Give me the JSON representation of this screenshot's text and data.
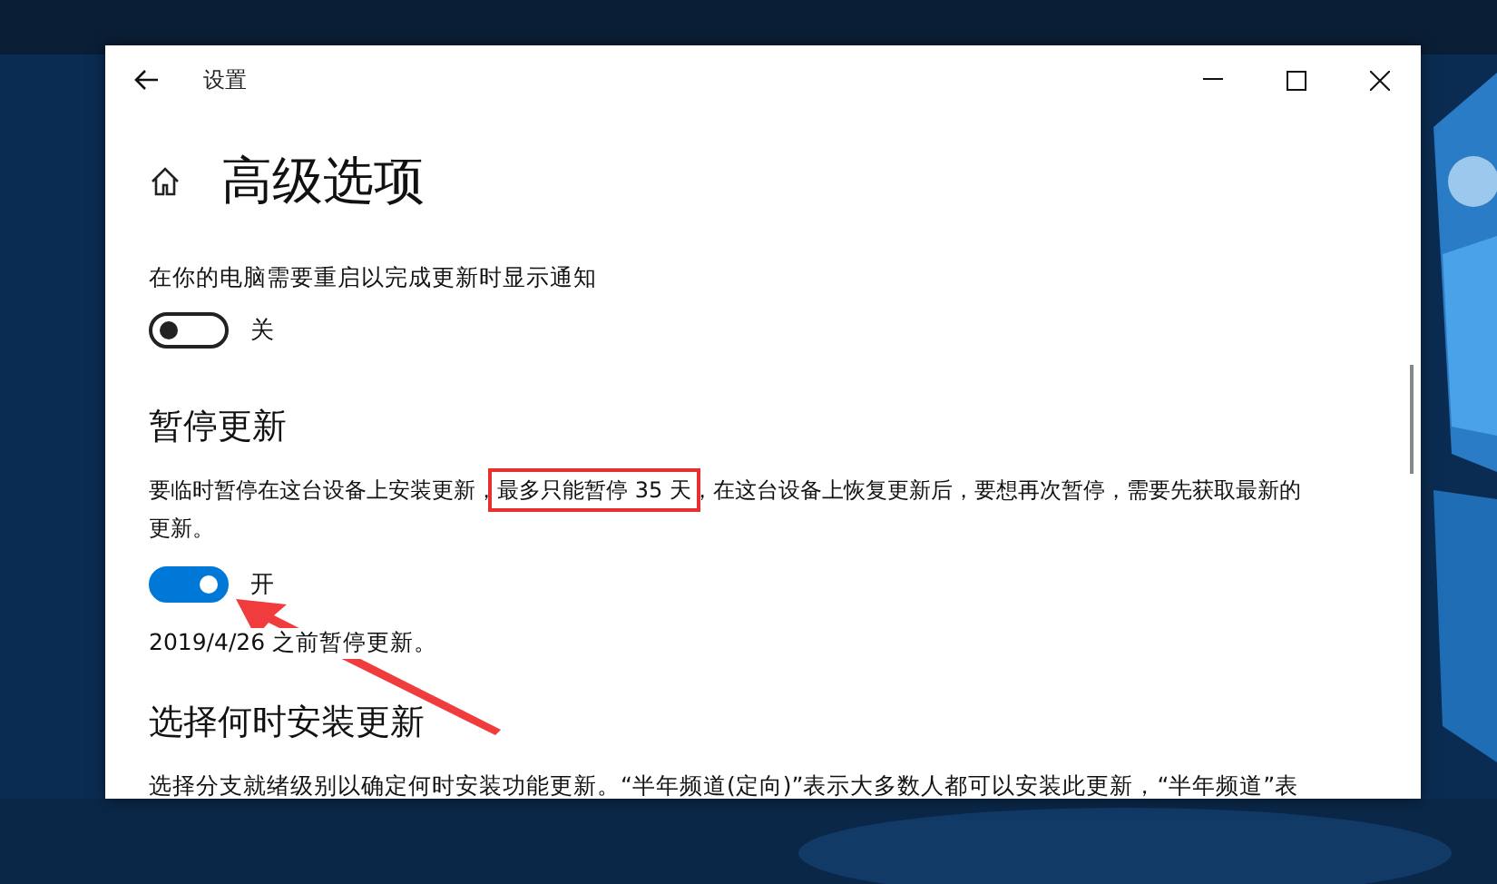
{
  "window": {
    "title": "设置"
  },
  "page": {
    "title": "高级选项"
  },
  "notify": {
    "label": "在你的电脑需要重启以完成更新时显示通知",
    "toggle": {
      "on": false,
      "label": "关"
    }
  },
  "pause": {
    "heading": "暂停更新",
    "description_before": "要临时暂停在这台设备上安装更新，",
    "description_highlight": "最多只能暂停 35 天",
    "description_after": "，在这台设备上恢复更新后，要想再次暂停，需要先获取最新的更新。",
    "toggle": {
      "on": true,
      "label": "开"
    },
    "status": "2019/4/26 之前暂停更新。"
  },
  "schedule": {
    "heading": "选择何时安装更新",
    "description": "选择分支就绪级别以确定何时安装功能更新。“半年频道(定向)”表示大多数人都可以安装此更新，“半年频道”表"
  }
}
